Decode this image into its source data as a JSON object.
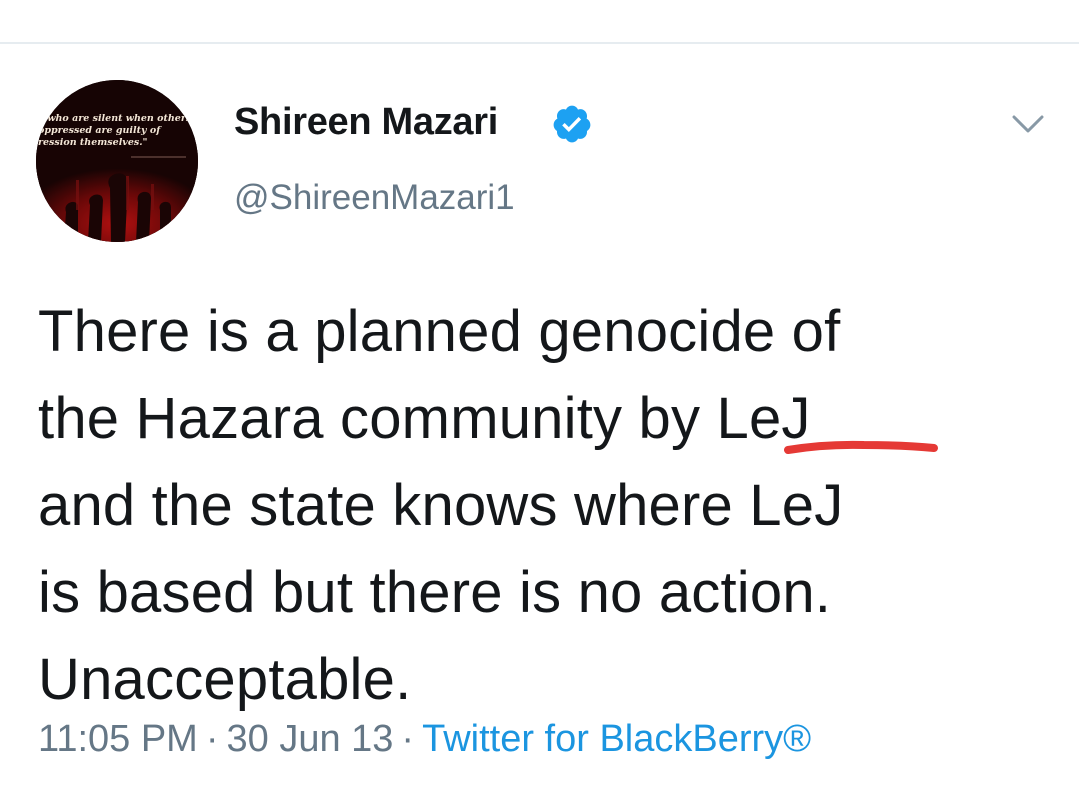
{
  "author": {
    "display_name": "Shireen Mazari",
    "handle": "@ShireenMazari1",
    "verified": true,
    "avatar_quote": [
      "e who are silent when others",
      "oppressed are guilty of",
      "ression themselves.\""
    ]
  },
  "tweet": {
    "lines": [
      "There is a planned genocide of",
      "the Hazara community by LeJ",
      "and the state knows where LeJ",
      "is based but there is no action.",
      "Unacceptable."
    ],
    "highlighted_term": "LeJ",
    "highlight_color": "#e53935"
  },
  "meta": {
    "time": "11:05 PM",
    "separator": "·",
    "date": "30 Jun 13",
    "source": "Twitter for BlackBerry®"
  },
  "icons": {
    "verified": "verified-badge-icon",
    "menu": "chevron-down-icon"
  },
  "colors": {
    "name": "#14171a",
    "secondary": "#657786",
    "link": "#1b95e0",
    "verified": "#1da1f2",
    "divider": "#e6ecf0"
  }
}
